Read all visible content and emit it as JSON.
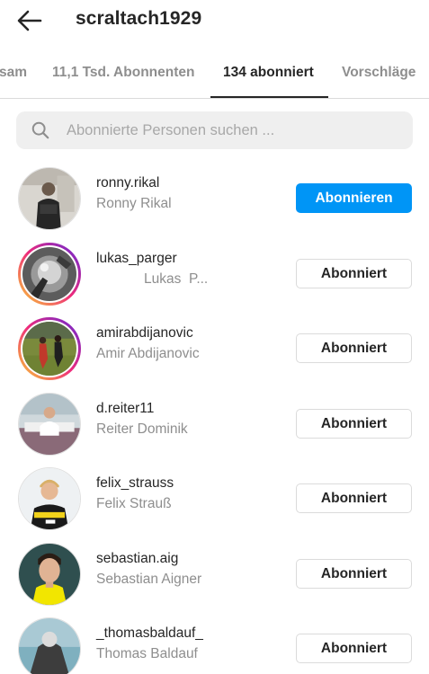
{
  "header": {
    "title": "scraltach1929",
    "back_icon": "arrow-left-icon"
  },
  "tabs": [
    {
      "label": "sam",
      "active": false
    },
    {
      "label": "11,1 Tsd. Abonnenten",
      "active": false
    },
    {
      "label": "134 abonniert",
      "active": true
    },
    {
      "label": "Vorschläge",
      "active": false
    }
  ],
  "search": {
    "placeholder": "Abonnierte Personen suchen ...",
    "value": "",
    "icon": "search-icon"
  },
  "colors": {
    "primary": "#0095f6",
    "text": "#262626",
    "secondary_text": "#8e8e8e",
    "border": "#dbdbdb"
  },
  "users": [
    {
      "username": "ronny.rikal",
      "fullname": "Ronny Rikal",
      "button": "Abonnieren",
      "story_ring": false
    },
    {
      "username": "lukas_parger",
      "fullname": "Lukas  P...",
      "button": "Abonniert",
      "story_ring": true
    },
    {
      "username": "amirabdijanovic",
      "fullname": "Amir Abdijanovic",
      "button": "Abonniert",
      "story_ring": true
    },
    {
      "username": "d.reiter11",
      "fullname": "Reiter Dominik",
      "button": "Abonniert",
      "story_ring": false
    },
    {
      "username": "felix_strauss",
      "fullname": "Felix Strauß",
      "button": "Abonniert",
      "story_ring": false
    },
    {
      "username": "sebastian.aig",
      "fullname": "Sebastian Aigner",
      "button": "Abonniert",
      "story_ring": false
    },
    {
      "username": "_thomasbaldauf_",
      "fullname": "Thomas Baldauf",
      "button": "Abonniert",
      "story_ring": false
    }
  ]
}
